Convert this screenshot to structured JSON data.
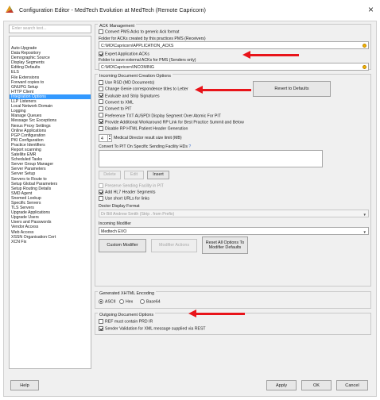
{
  "window": {
    "title": "Configuration Editor - MedTech Evolution at MedTech (Remote Capricorn)",
    "close_glyph": "×"
  },
  "sidebar": {
    "search_placeholder": "Enter search text...",
    "items": [
      "Auto-Upgrade",
      "Data Repository",
      "Demographic Source",
      "Display Segments",
      "Editing Defaults",
      "ELS",
      "File Extensions",
      "Forward copies to",
      "GNUPG Setup",
      "HTTP Client",
      "Integration Options",
      "LLP Listeners",
      "Local Network Domain",
      "Logging",
      "Manage Queues",
      "Message Src Exceptions",
      "Nexus Proxy Settings",
      "Online Applications",
      "PGP Configuration",
      "PKI Configuration",
      "Practice Identifiers",
      "Report scanning",
      "Satellite EMR",
      "Scheduled Tasks",
      "Server Group Manager",
      "Server Parameters",
      "Server Setup",
      "Servers to Route to",
      "Setup Global Parameters",
      "Setup Routing Details",
      "SMD Agent",
      "Snomed Lookup",
      "Specific Servers",
      "TLS Servers",
      "Upgrade Applications",
      "Upgrade Users",
      "Users and Passwords",
      "Vendor Access",
      "Web Access",
      "XSSN Organisation Cert",
      "XCN Fix"
    ],
    "selected_index": 10
  },
  "ack": {
    "group_title": "ACK Management",
    "convert_pms_acks": "Convert PMS Acks to generic Ack format",
    "folder_label": "Folder for ACKs created by this practices PMS (Receivers)",
    "folder_value": "C:\\MO\\Capricorn\\APPLICATION_ACKS",
    "expert_acks": "Expert Application ACKs",
    "external_label": "Folder to save external ACKs for PMS (Senders only)",
    "external_value": "C:\\MO\\Capricorn\\INCOMING"
  },
  "incoming": {
    "group_title": "Incoming Document Creation Options",
    "options": [
      {
        "label": "Use RSD (MD Documents)",
        "checked": false
      },
      {
        "label": "Change Genie correspondence titles to Letter",
        "checked": false
      },
      {
        "label": "Evaluate and Strip Signatures",
        "checked": true
      },
      {
        "label": "Convert to XML",
        "checked": false
      },
      {
        "label": "Convert to PIT",
        "checked": false
      },
      {
        "label": "Preference TXT AUSPDI Display Segment Over Atomic For PIT",
        "checked": false
      },
      {
        "label": "Provide Additional Workaround RP Link for Best Practice Summit and Below",
        "checked": true
      },
      {
        "label": "Disable RP HTML Patient Header Generation",
        "checked": false
      }
    ],
    "revert_button": "Revert to Defaults",
    "medical_director_value": "4",
    "medical_director_label": "Medical Director result size limit (MB)",
    "convert_pit_label": "Convert To PIT On Specific Sending Facility HDs",
    "help_glyph": "?",
    "delete_button": "Delete",
    "edit_button": "Edit",
    "insert_button": "Insert",
    "preserve_label": "Preserve Sending Facility in PIT",
    "add_hl7_label": "Add HL7 Header Segments",
    "short_urls_label": "Use short URLs for links",
    "doctor_format_label": "Doctor Display Format",
    "doctor_format_value": "Dr Bill Andrew Smith (Strip . from Prefix)",
    "incoming_modifier_label": "Incoming Modifier",
    "incoming_modifier_value": "Medtech EVO",
    "custom_modifier_button": "Custom Modifier",
    "modifier_actions_button": "Modifier Actions",
    "reset_button": "Reset All Options To Modifier Defaults"
  },
  "encoding": {
    "group_title": "Generated XHTML Encoding",
    "options": [
      "ASCII",
      "Hex",
      "Base64"
    ],
    "selected": "ASCII"
  },
  "outgoing": {
    "group_title": "Outgoing Document Options",
    "options": [
      {
        "label": "REF must contain PRD IR",
        "checked": false
      },
      {
        "label": "Sender Validation for XML message supplied via REST",
        "checked": true
      }
    ]
  },
  "footer": {
    "help": "Help",
    "apply": "Apply",
    "ok": "OK",
    "cancel": "Cancel"
  },
  "colors": {
    "annotation_arrow": "#e8141a",
    "selection": "#3399ff"
  }
}
